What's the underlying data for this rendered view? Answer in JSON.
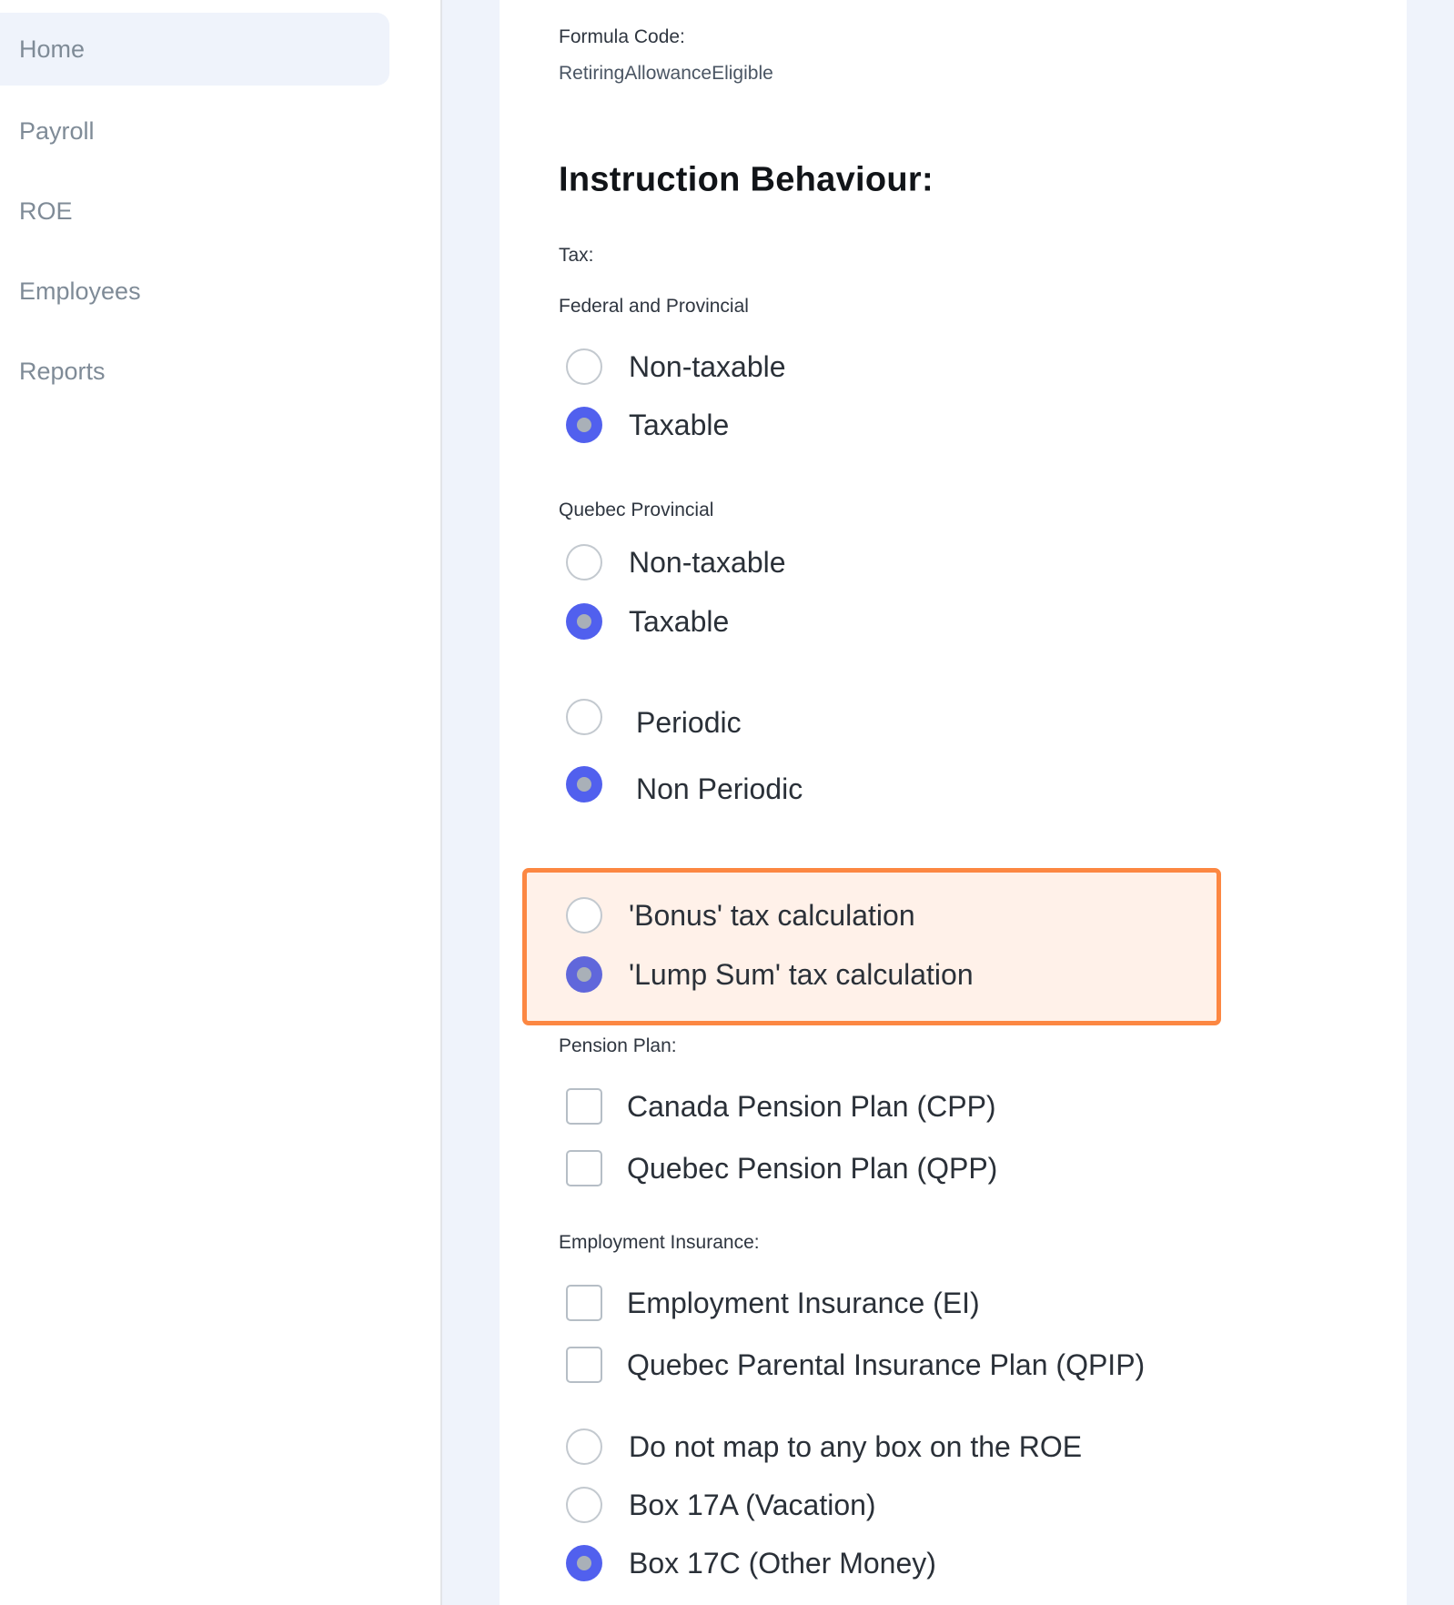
{
  "sidebar": {
    "items": [
      {
        "label": "Home",
        "active": true
      },
      {
        "label": "Payroll",
        "active": false
      },
      {
        "label": "ROE",
        "active": false
      },
      {
        "label": "Employees",
        "active": false
      },
      {
        "label": "Reports",
        "active": false
      }
    ]
  },
  "formula": {
    "label": "Formula Code:",
    "value": "RetiringAllowanceEligible"
  },
  "instruction": {
    "heading": "Instruction Behaviour:",
    "tax": {
      "label": "Tax:",
      "federal": {
        "label": "Federal and Provincial",
        "options": [
          "Non-taxable",
          "Taxable"
        ],
        "selected": "Taxable"
      },
      "quebec": {
        "label": "Quebec Provincial",
        "options": [
          "Non-taxable",
          "Taxable"
        ],
        "selected": "Taxable"
      },
      "periodicity": {
        "options": [
          "Periodic",
          "Non Periodic"
        ],
        "selected": "Non Periodic"
      },
      "calculation": {
        "options": [
          "'Bonus' tax calculation",
          "'Lump Sum' tax calculation"
        ],
        "selected": "'Lump Sum' tax calculation",
        "highlight_color": "#fc8742"
      }
    },
    "pension": {
      "label": "Pension Plan:",
      "options": [
        {
          "label": "Canada Pension Plan (CPP)",
          "checked": false
        },
        {
          "label": "Quebec Pension Plan (QPP)",
          "checked": false
        }
      ]
    },
    "employment_insurance": {
      "label": "Employment Insurance:",
      "options": [
        {
          "label": "Employment Insurance (EI)",
          "checked": false
        },
        {
          "label": "Quebec Parental Insurance Plan (QPIP)",
          "checked": false
        }
      ]
    },
    "roe": {
      "options": [
        "Do not map to any box on the ROE",
        "Box 17A (Vacation)",
        "Box 17C (Other Money)"
      ],
      "selected": "Box 17C (Other Money)"
    }
  },
  "colors": {
    "accent": "#5160ee",
    "highlight_border": "#fc8742",
    "highlight_bg": "#fff1e9",
    "sidebar_active_bg": "#eff3fb"
  }
}
